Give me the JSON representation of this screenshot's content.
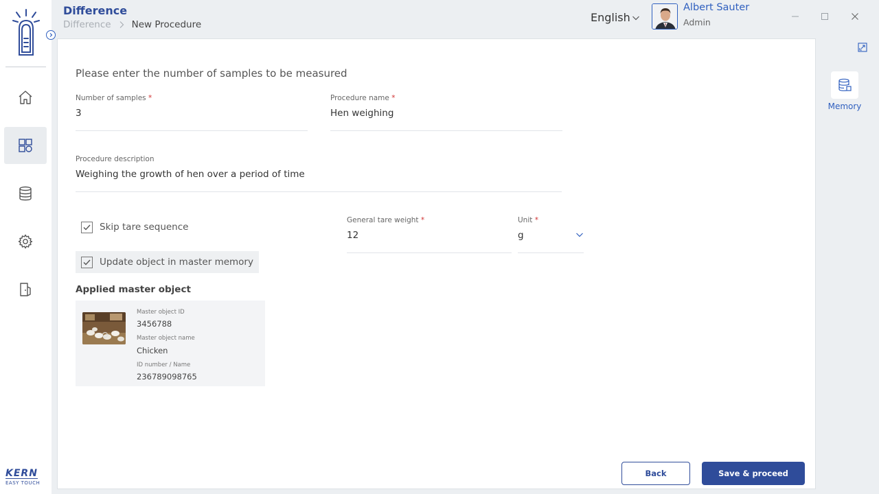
{
  "header": {
    "title": "Difference",
    "breadcrumb": {
      "parent": "Difference",
      "current": "New Procedure"
    },
    "language": "English",
    "user": {
      "name": "Albert Sauter",
      "role": "Admin"
    }
  },
  "sidebar": {
    "items": [
      {
        "icon": "home-icon",
        "active": false
      },
      {
        "icon": "dashboard-icon",
        "active": true
      },
      {
        "icon": "database-icon",
        "active": false
      },
      {
        "icon": "gear-icon",
        "active": false
      },
      {
        "icon": "logout-icon",
        "active": false
      }
    ],
    "brand": {
      "name": "KERN",
      "tagline": "EASY TOUCH"
    }
  },
  "form": {
    "prompt": "Please enter the number of samples to be measured",
    "num_samples": {
      "label": "Number of samples",
      "value": "3"
    },
    "procedure_name": {
      "label": "Procedure name",
      "value": "Hen weighing"
    },
    "procedure_description": {
      "label": "Procedure description",
      "value": "Weighing the growth of hen over a period of time"
    },
    "skip_tare": {
      "label": "Skip tare sequence",
      "checked": true
    },
    "update_master": {
      "label": "Update object in master memory",
      "checked": true
    },
    "tare_weight": {
      "label": "General tare weight",
      "value": "12"
    },
    "unit": {
      "label": "Unit",
      "value": "g"
    },
    "required_marker": "*"
  },
  "master_object": {
    "heading": "Applied master object",
    "id_label": "Master object ID",
    "id_value": "3456788",
    "name_label": "Master object name",
    "name_value": "Chicken",
    "number_label": "ID number / Name",
    "number_value": "236789098765"
  },
  "actions": {
    "back": "Back",
    "save": "Save & proceed"
  },
  "right_panel": {
    "memory_label": "Memory"
  },
  "colors": {
    "accent": "#2f4c9a",
    "link": "#2f5fbf",
    "required": "#d03131",
    "background": "#eceff2"
  }
}
